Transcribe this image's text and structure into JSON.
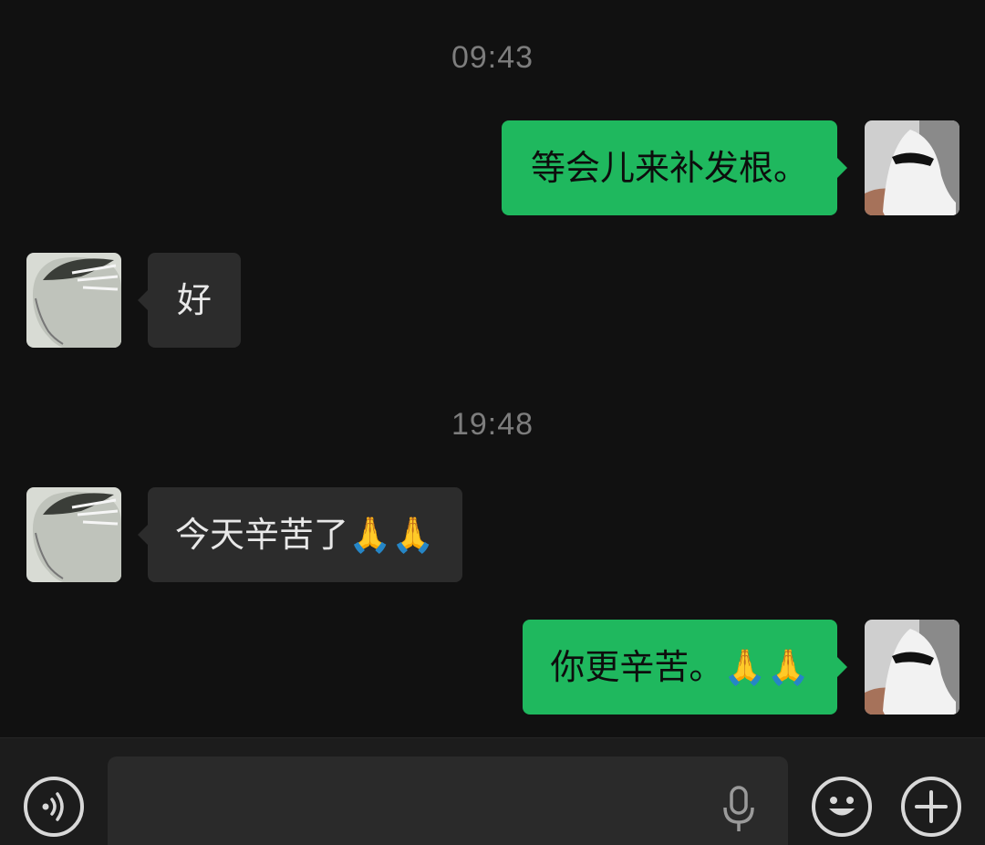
{
  "messages": [
    {
      "type": "time",
      "text": "09:43"
    },
    {
      "type": "message",
      "direction": "out",
      "text": "等会儿来补发根。"
    },
    {
      "type": "message",
      "direction": "in",
      "text": "好"
    },
    {
      "type": "time",
      "text": "19:48"
    },
    {
      "type": "message",
      "direction": "in",
      "text": "今天辛苦了🙏🙏"
    },
    {
      "type": "message",
      "direction": "out",
      "text": "你更辛苦。🙏🙏"
    }
  ],
  "input_bar": {
    "voice_icon": "voice-icon",
    "text_value": "",
    "placeholder": "",
    "mic_icon": "microphone-icon",
    "emoji_icon": "emoji-icon",
    "plus_icon": "plus-icon"
  },
  "colors": {
    "background": "#111111",
    "outgoing_bubble": "#1fb85e",
    "incoming_bubble": "#2c2c2c",
    "timestamp": "#7d7d7d"
  }
}
